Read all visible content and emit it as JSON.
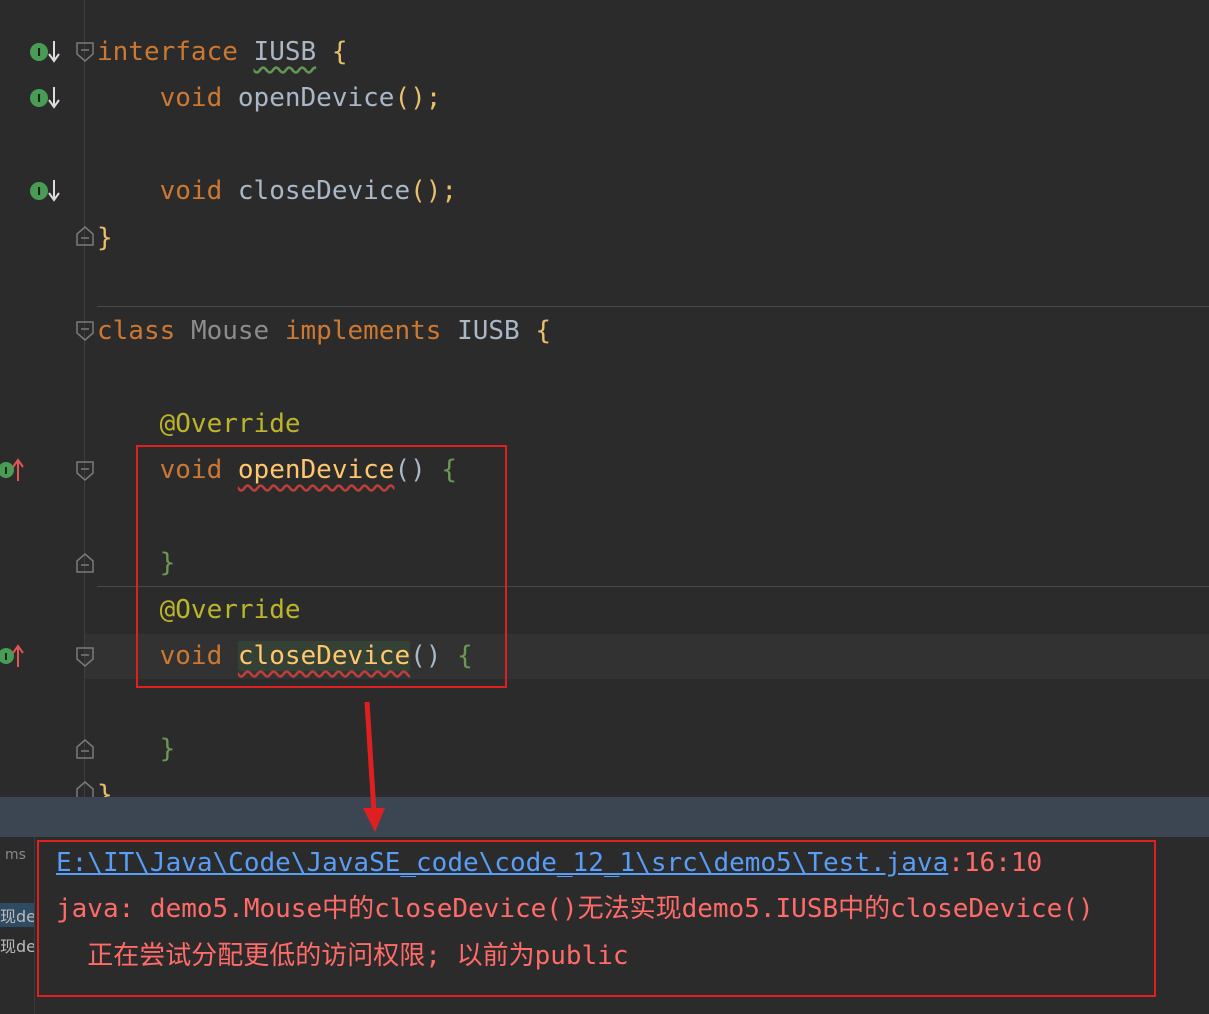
{
  "code": {
    "iface_kw": "interface",
    "iface_name": "IUSB",
    "open_brace": "{",
    "close_brace": "}",
    "void_kw": "void",
    "open_method": "openDevice",
    "close_method": "closeDevice",
    "call_suffix": "();",
    "class_kw": "class",
    "class_name": "Mouse",
    "implements_kw": "implements",
    "annotation": "@Override",
    "method_parens": "()"
  },
  "gutter": {
    "implemented_icon": "interface-implemented-icon",
    "implementing_icon": "method-implementing-icon",
    "fold_icon": "fold-icon"
  },
  "left_panel": {
    "ms_label": "ms",
    "row1": "现de",
    "row2": "现de"
  },
  "output": {
    "file_link": "E:\\IT\\Java\\Code\\JavaSE_code\\code_12_1\\src\\demo5\\Test.java",
    "file_pos": ":16:10",
    "error_line": "java: demo5.Mouse中的closeDevice()无法实现demo5.IUSB中的closeDevice()",
    "detail_line": "  正在尝试分配更低的访问权限; 以前为public"
  },
  "colors": {
    "highlight_box": "#e02020",
    "error_text": "#ff6b68",
    "link": "#589df6"
  }
}
